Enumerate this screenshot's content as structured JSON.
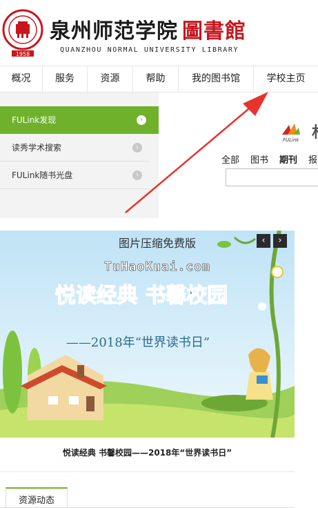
{
  "header": {
    "title": "泉州师范学院",
    "title_library": "圖書館",
    "subtitle": "QUANZHOU NORMAL UNIVERSITY LIBRARY",
    "seal_year": "1958"
  },
  "nav": {
    "items": [
      "概况",
      "服务",
      "资源",
      "帮助",
      "我的图书馆",
      "学校主页"
    ]
  },
  "side_menu": {
    "items": [
      {
        "label": "FULink发现",
        "active": true
      },
      {
        "label": "读秀学术搜索",
        "active": false
      },
      {
        "label": "FULink随书光盘",
        "active": false
      }
    ]
  },
  "search": {
    "logo_text": "FULink",
    "logo_partial": "杉",
    "tabs": [
      "全部",
      "图书",
      "期刊",
      "报"
    ],
    "active_tab": "期刊",
    "input_value": ""
  },
  "banner": {
    "watermark_line1": "图片压缩免费版",
    "watermark_line2": "TuHaoKuai.com",
    "headline": "悦读经典  书馨校园",
    "subline": "——2018年“世界读书日”",
    "prev_icon": "‹",
    "next_icon": "›",
    "caption": "悦读经典 书馨校园——2018年“世界读书日”"
  },
  "bottom_tab": {
    "label": "资源动态"
  },
  "colors": {
    "accent_green": "#6fb12b",
    "brand_red": "#c8161d",
    "annotation_red": "#e8322d"
  }
}
